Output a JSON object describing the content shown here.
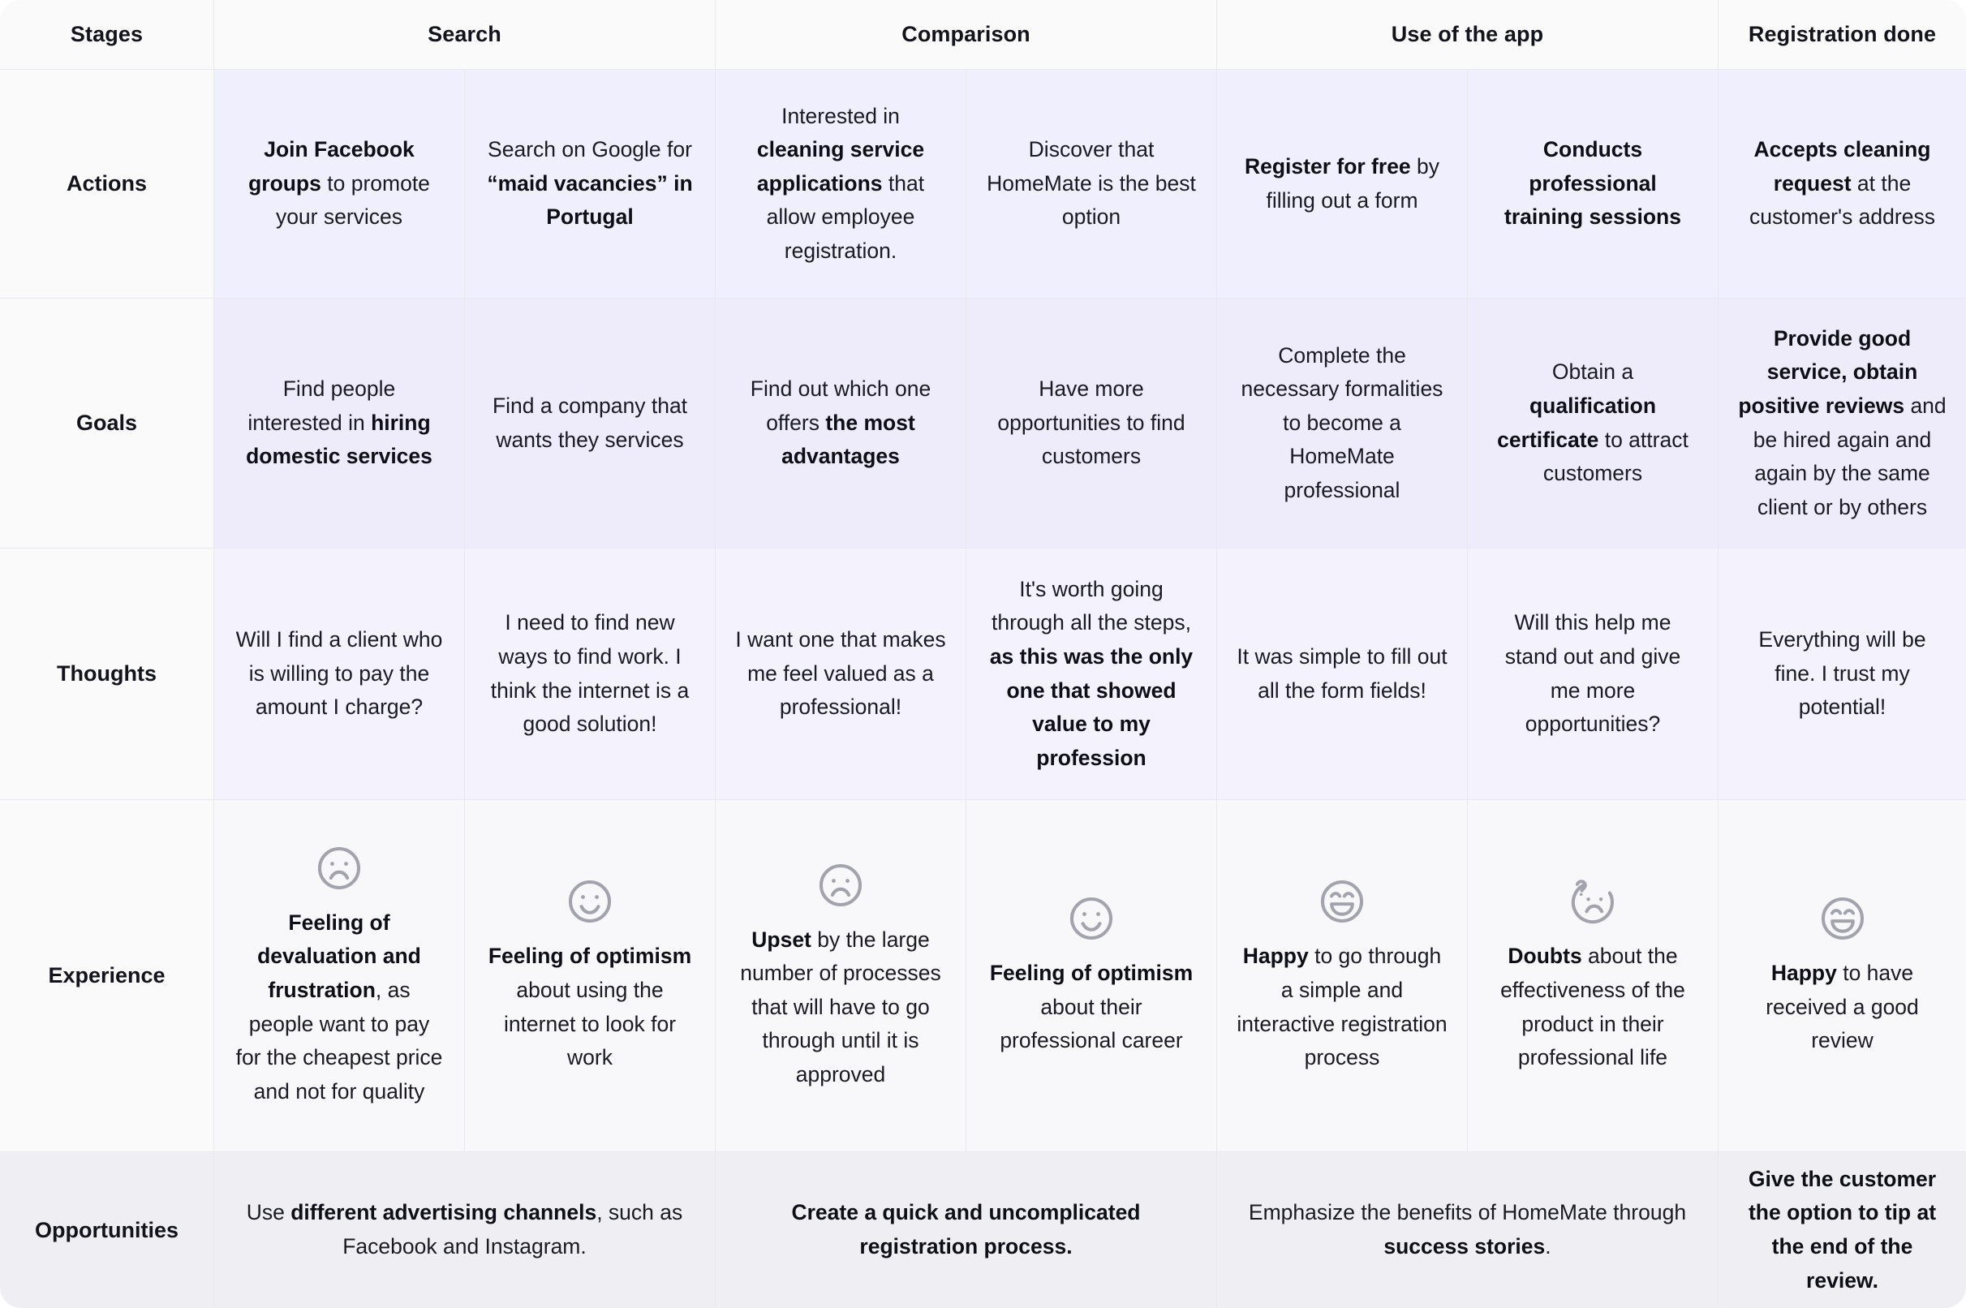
{
  "map": {
    "row_label_header": "Stages",
    "stages": [
      {
        "label": "Search",
        "span": 2
      },
      {
        "label": "Comparison",
        "span": 2
      },
      {
        "label": "Use of the app",
        "span": 2
      },
      {
        "label": "Registration done",
        "span": 1
      }
    ],
    "rows": [
      {
        "label": "Actions",
        "cells": [
          {
            "html": "<strong>Join Facebook groups</strong> to promote your services"
          },
          {
            "html": "Search on Google for <strong>“maid vacancies” in Portugal</strong>"
          },
          {
            "html": "Interested in <strong>cleaning service applications</strong> that allow employee registration."
          },
          {
            "html": "Discover that HomeMate is the best option"
          },
          {
            "html": "<strong>Register for free</strong> by filling out a form"
          },
          {
            "html": "<strong>Conducts professional training sessions</strong>"
          },
          {
            "html": "<strong>Accepts cleaning request</strong> at the customer's address"
          }
        ]
      },
      {
        "label": "Goals",
        "cells": [
          {
            "html": "Find people interested in <strong>hiring domestic services</strong>"
          },
          {
            "html": "Find a company that wants they services"
          },
          {
            "html": "Find out which one offers <strong>the most advantages</strong>"
          },
          {
            "html": "Have more opportunities to find customers"
          },
          {
            "html": "Complete the necessary formalities to become a HomeMate professional"
          },
          {
            "html": "Obtain a <strong>qualification certificate</strong> to attract customers"
          },
          {
            "html": "<strong>Provide good service, obtain positive reviews</strong> and be hired again and again by the same client or by others"
          }
        ]
      },
      {
        "label": "Thoughts",
        "cells": [
          {
            "html": "Will I find a client who is willing to pay the amount I charge?"
          },
          {
            "html": "I need to find new ways to find work. I think the internet is a good solution!"
          },
          {
            "html": "I want one that makes me feel valued as a professional!"
          },
          {
            "html": "It's worth going through all the steps, <strong>as this was the only one that showed value to my profession</strong>"
          },
          {
            "html": "It was simple to fill out all the form fields!"
          },
          {
            "html": "Will this help me stand out and give me more opportunities?"
          },
          {
            "html": "Everything will be fine. I trust my potential!"
          }
        ]
      },
      {
        "label": "Experience",
        "cells": [
          {
            "icon": "sad-face-icon",
            "html": "<strong>Feeling of devaluation and frustration</strong>, as people want to pay for the cheapest price and not for quality"
          },
          {
            "icon": "smile-face-icon",
            "html": "<strong>Feeling of optimism</strong> about using the internet to look for work"
          },
          {
            "icon": "sad-face-icon",
            "html": "<strong>Upset</strong> by the large number of processes that will have to go through until it is approved"
          },
          {
            "icon": "smile-face-icon",
            "html": "<strong>Feeling of optimism</strong> about their professional career"
          },
          {
            "icon": "grin-face-icon",
            "html": "<strong>Happy</strong> to go through a simple and interactive registration process"
          },
          {
            "icon": "confused-face-icon",
            "html": "<strong>Doubts</strong> about the effectiveness of the product in their professional life"
          },
          {
            "icon": "grin-face-icon",
            "html": "<strong>Happy</strong> to have received a good review"
          }
        ]
      },
      {
        "label": "Opportunities",
        "cells": [
          {
            "span": 2,
            "html": "Use <strong>different advertising channels</strong>, such as Facebook and Instagram."
          },
          {
            "span": 2,
            "html": "<strong>Create a quick and uncomplicated registration process.</strong>"
          },
          {
            "span": 2,
            "html": "Emphasize the benefits of HomeMate through <strong>success stories</strong>."
          },
          {
            "span": 1,
            "html": "<strong>Give the customer the option to tip at the end of the review.</strong>"
          }
        ]
      }
    ],
    "colors": {
      "canvas": "#fafafb",
      "actions_row": "#f0effd",
      "goals_row": "#eeecfb",
      "thoughts_row": "#f4f3fd",
      "experience_row": "#f8f8fb",
      "opportunities_row": "#eeeef3",
      "grid_line": "#e8e8ef",
      "text": "#1a1a22",
      "icon_stroke": "#a3a3ad"
    }
  }
}
